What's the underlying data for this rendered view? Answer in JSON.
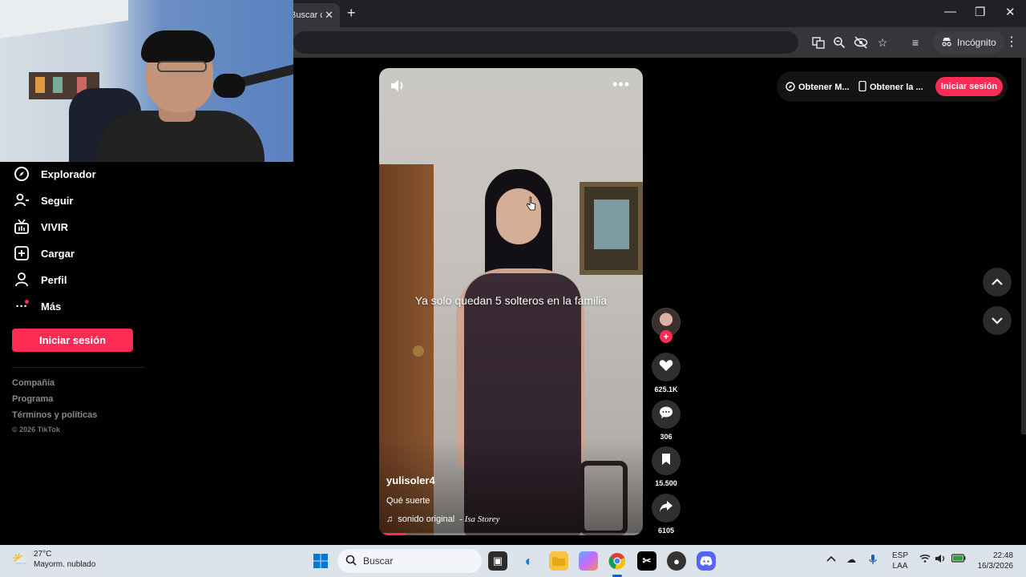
{
  "browser": {
    "tab_title": "Buscar co",
    "incognito_label": "Incógnito",
    "window_controls": [
      "minimize-icon",
      "restore-icon",
      "close-icon"
    ]
  },
  "sidebar": {
    "items": [
      {
        "label": "Explorador",
        "icon": "compass-icon"
      },
      {
        "label": "Seguir",
        "icon": "follow-user-icon"
      },
      {
        "label": "VIVIR",
        "icon": "live-tv-icon"
      },
      {
        "label": "Cargar",
        "icon": "upload-plus-icon"
      },
      {
        "label": "Perfil",
        "icon": "profile-icon"
      },
      {
        "label": "Más",
        "icon": "more-dots-icon"
      }
    ],
    "login_label": "Iniciar sesión",
    "footer_links": [
      "Compañía",
      "Programa",
      "Términos y políticas"
    ],
    "copyright": "© 2026 TikTok"
  },
  "header_actions": {
    "get_app_label": "Obtener M...",
    "get_app2_label": "Obtener la ...",
    "login_label": "Iniciar sesión"
  },
  "video": {
    "caption": "Ya solo quedan 5 solteros en la familia",
    "username": "yulisoler4",
    "description": "Qué suerte",
    "sound": "sonido original",
    "artist": "- Isa Storey",
    "progress_fraction": 0.1
  },
  "actions": {
    "likes": "625.1K",
    "comments": "306",
    "saves": "15.500",
    "shares": "6105"
  },
  "taskbar": {
    "temperature": "27°C",
    "weather": "Mayorm. nublado",
    "search_placeholder": "Buscar",
    "lang1": "ESP",
    "lang2": "LAA",
    "time": "22:48",
    "date": "16/3/2026"
  },
  "colors": {
    "accent": "#fe2c55",
    "background": "#000000",
    "taskbar": "#dde3ea"
  }
}
